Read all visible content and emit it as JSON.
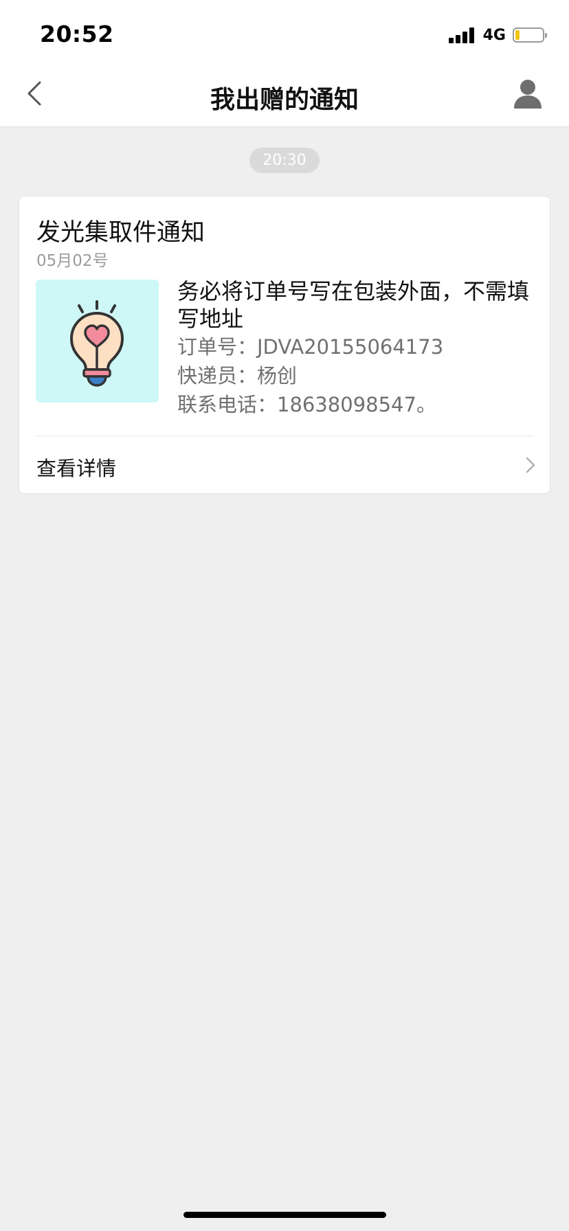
{
  "status_bar": {
    "time": "20:52",
    "network": "4G",
    "battery_level": 0.15,
    "battery_color": "#f1c40f"
  },
  "nav": {
    "title": "我出赠的通知",
    "back_icon": "chevron-left-icon",
    "profile_icon": "user-icon"
  },
  "timestamp": "20:30",
  "notification": {
    "title": "发光集取件通知",
    "date": "05月02号",
    "thumbnail_icon": "lightbulb-heart-icon",
    "thumbnail_bg": "#cef7f7",
    "message": "务必将订单号写在包装外面，不需填写地址",
    "order_line": "订单号：JDVA20155064173",
    "courier_line": "快递员：杨创",
    "phone_line": "联系电话：18638098547。",
    "detail_label": "查看详情"
  }
}
